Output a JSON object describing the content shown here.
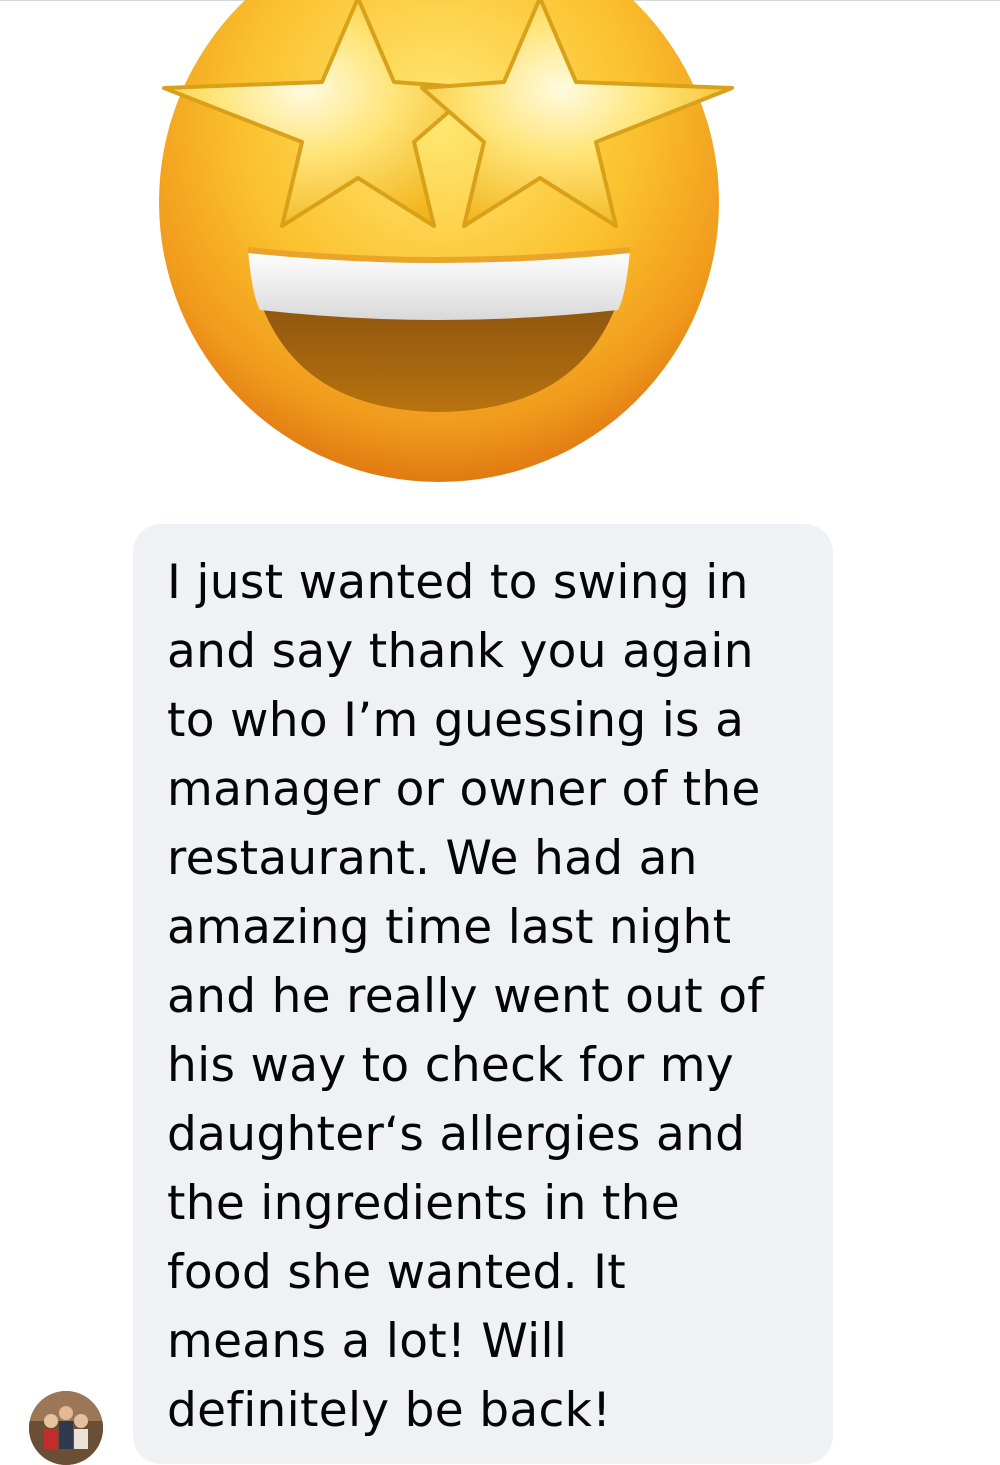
{
  "header": {
    "reaction_emoji": "star-struck-emoji"
  },
  "message": {
    "lines": [
      "I just wanted to swing in",
      "and say thank you again",
      "to who I’m guessing is a",
      "manager or owner of the",
      "restaurant. We had an",
      "amazing time last night",
      "and he really went out of",
      "his way to check for my",
      "daughter‘s allergies and",
      "the ingredients in the",
      "food she wanted. It",
      "means a lot! Will",
      "definitely be back!"
    ],
    "bubble_color": "#f0f1f5",
    "text_color": "#050505"
  },
  "sender": {
    "avatar": "sender-avatar-photo"
  }
}
